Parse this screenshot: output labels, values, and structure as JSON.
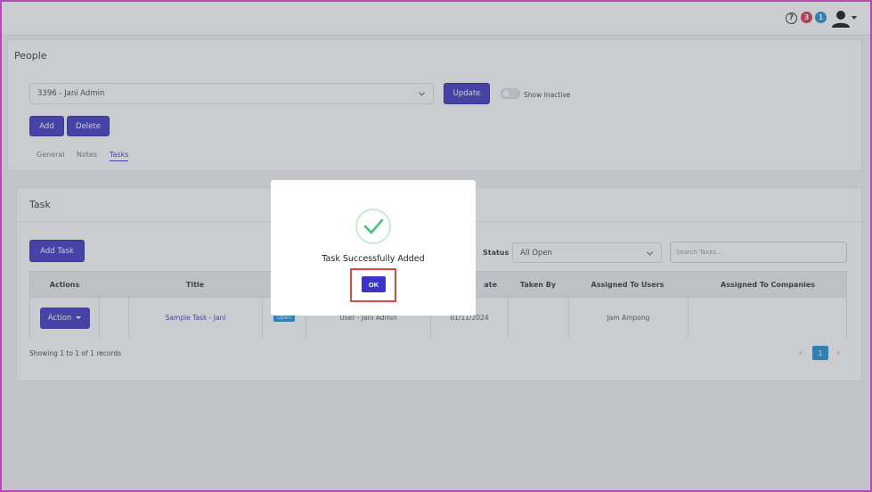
{
  "header": {
    "help_icon": "help-circle-icon",
    "help_glyph": "?",
    "notification_count_red": "3",
    "notification_count_blue": "1",
    "user_icon": "user-avatar-icon"
  },
  "people": {
    "title": "People",
    "selected_person": "3396 - Jani Admin",
    "update_label": "Update",
    "show_inactive_label": "Show Inactive",
    "add_label": "Add",
    "delete_label": "Delete",
    "tabs": [
      {
        "label": "General",
        "active": false
      },
      {
        "label": "Notes",
        "active": false
      },
      {
        "label": "Tasks",
        "active": true
      }
    ]
  },
  "task": {
    "title": "Task",
    "add_task_label": "Add Task",
    "status_label": "Status",
    "status_value": "All Open",
    "search_placeholder": "Search Tasks...",
    "columns": [
      "Actions",
      "Title",
      "ate",
      "Taken By",
      "Assigned To Users",
      "Assigned To Companies"
    ],
    "rows": [
      {
        "action_label": "Action",
        "title": "Sample Task - Jani",
        "status": "Open",
        "created_by": "User - Jani Admin",
        "date": "01/11/2024",
        "taken_by": "",
        "assigned_users": "Jam Ampong",
        "assigned_companies": ""
      }
    ],
    "records_text": "Showing 1 to 1 of 1 records",
    "pagination": {
      "prev": "‹",
      "current_page": "1",
      "next": "›"
    }
  },
  "modal": {
    "icon": "check-circle-icon",
    "message": "Task Successfully Added",
    "ok_label": "OK"
  },
  "colors": {
    "primary": "#3b35c3",
    "info": "#1d8fd6",
    "danger": "#d9304e",
    "success": "#4cc27a",
    "highlight": "#e0483d"
  }
}
